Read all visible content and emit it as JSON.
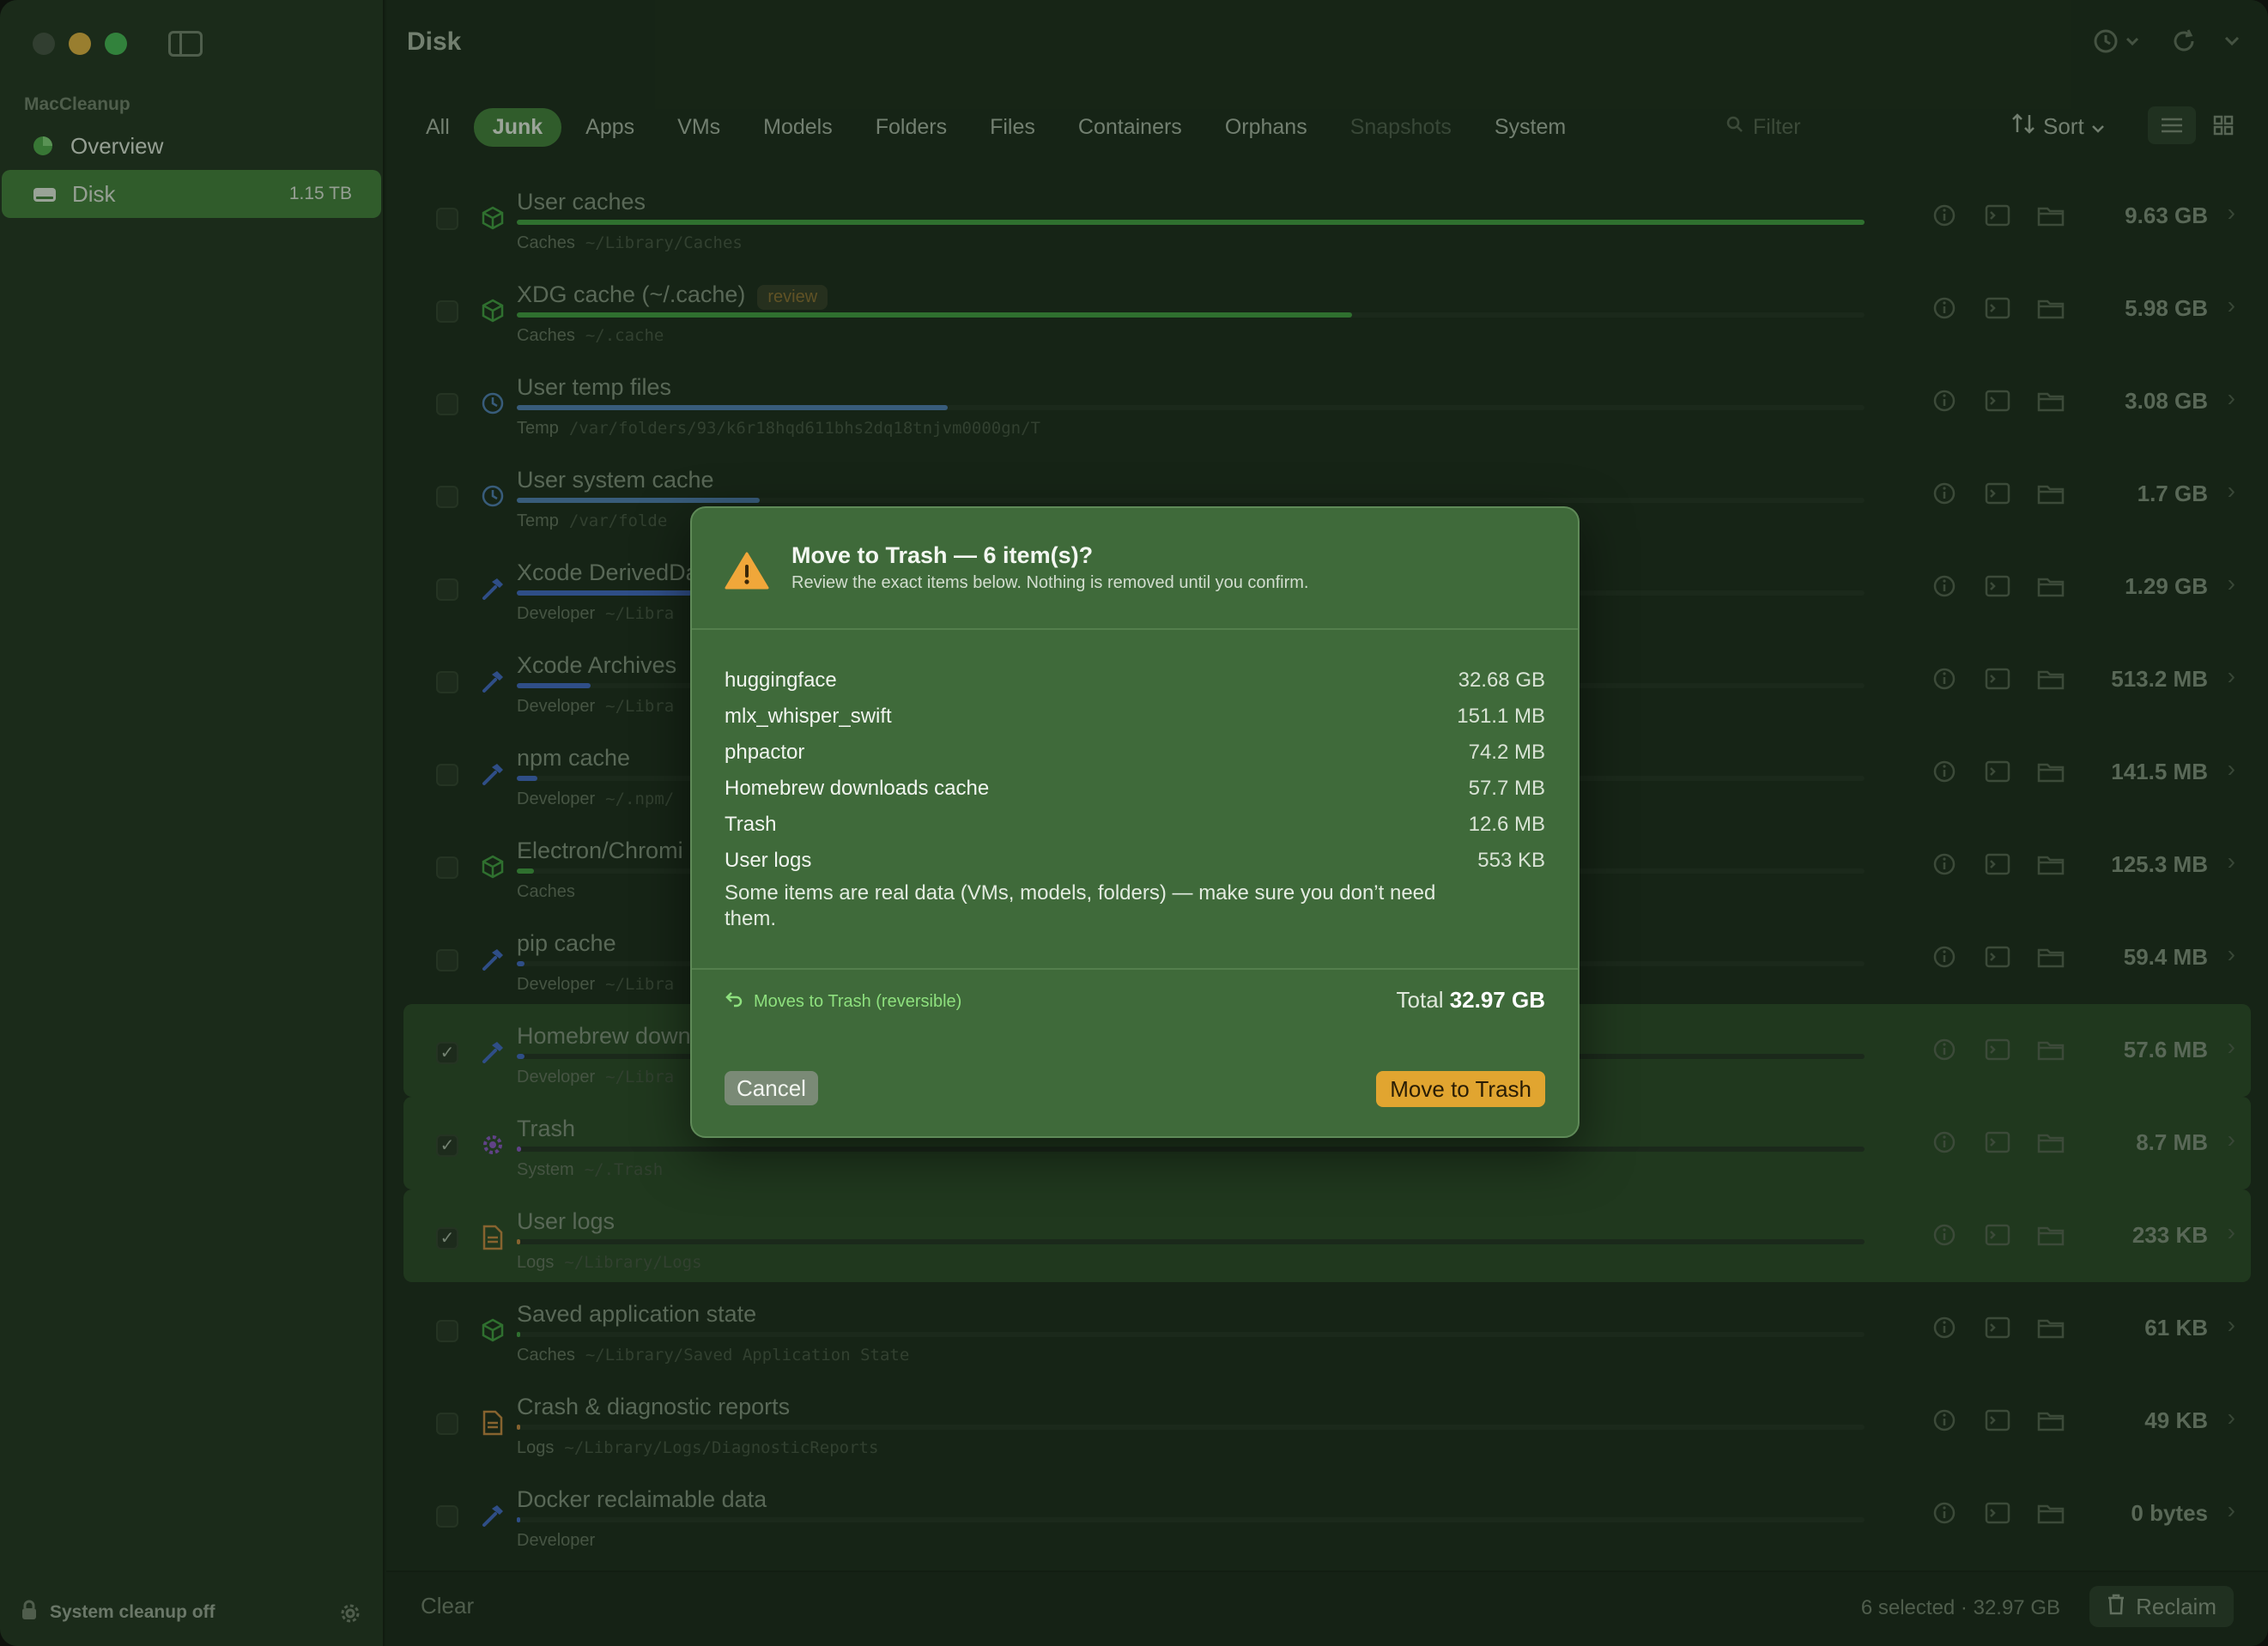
{
  "sidebar": {
    "section": "MacCleanup",
    "items": [
      {
        "label": "Overview",
        "badge": ""
      },
      {
        "label": "Disk",
        "badge": "1.15 TB"
      }
    ],
    "footer": "System cleanup off"
  },
  "header": {
    "title": "Disk",
    "tabs": [
      "All",
      "Junk",
      "Apps",
      "VMs",
      "Models",
      "Folders",
      "Files",
      "Containers",
      "Orphans",
      "Snapshots",
      "System"
    ],
    "active_tab": "Junk",
    "filter_placeholder": "Filter",
    "sort_label": "Sort"
  },
  "rows": [
    {
      "name": "User caches",
      "tag": "",
      "category": "Caches",
      "path": "~/Library/Caches",
      "size": "9.63 GB",
      "fill": 1.0,
      "color": "#3b9a3a",
      "icon": "box-icon",
      "checked": false
    },
    {
      "name": "XDG cache (~/.cache)",
      "tag": "review",
      "category": "Caches",
      "path": "~/.cache",
      "size": "5.98 GB",
      "fill": 0.62,
      "color": "#3b9a3a",
      "icon": "box-icon",
      "checked": false
    },
    {
      "name": "User temp files",
      "tag": "",
      "category": "Temp",
      "path": "/var/folders/93/k6r18hqd611bhs2dq18tnjvm0000gn/T",
      "size": "3.08 GB",
      "fill": 0.32,
      "color": "#4a7ab5",
      "icon": "clock-icon",
      "checked": false
    },
    {
      "name": "User system cache",
      "tag": "",
      "category": "Temp",
      "path": "/var/folde",
      "size": "1.7 GB",
      "fill": 0.18,
      "color": "#4a7ab5",
      "icon": "clock-icon",
      "checked": false
    },
    {
      "name": "Xcode DerivedDa",
      "tag": "",
      "category": "Developer",
      "path": "~/Libra",
      "size": "1.29 GB",
      "fill": 0.13,
      "color": "#3a63c8",
      "icon": "hammer-icon",
      "checked": false
    },
    {
      "name": "Xcode Archives",
      "tag": "",
      "category": "Developer",
      "path": "~/Libra",
      "size": "513.2 MB",
      "fill": 0.055,
      "color": "#3a63c8",
      "icon": "hammer-icon",
      "checked": false
    },
    {
      "name": "npm cache",
      "tag": "",
      "category": "Developer",
      "path": "~/.npm/",
      "size": "141.5 MB",
      "fill": 0.015,
      "color": "#3a63c8",
      "icon": "hammer-icon",
      "checked": false
    },
    {
      "name": "Electron/Chromi",
      "tag": "",
      "category": "Caches",
      "path": "",
      "size": "125.3 MB",
      "fill": 0.013,
      "color": "#3b9a3a",
      "icon": "box-icon",
      "checked": false
    },
    {
      "name": "pip cache",
      "tag": "",
      "category": "Developer",
      "path": "~/Libra",
      "size": "59.4 MB",
      "fill": 0.006,
      "color": "#3a63c8",
      "icon": "hammer-icon",
      "checked": false
    },
    {
      "name": "Homebrew down",
      "tag": "",
      "category": "Developer",
      "path": "~/Libra",
      "size": "57.6 MB",
      "fill": 0.006,
      "color": "#3a63c8",
      "icon": "hammer-icon",
      "checked": true
    },
    {
      "name": "Trash",
      "tag": "",
      "category": "System",
      "path": "~/.Trash",
      "size": "8.7 MB",
      "fill": 0.003,
      "color": "#8a4fc8",
      "icon": "gear-icon",
      "checked": true
    },
    {
      "name": "User logs",
      "tag": "",
      "category": "Logs",
      "path": "~/Library/Logs",
      "size": "233 KB",
      "fill": 0.002,
      "color": "#c9853a",
      "icon": "document-icon",
      "checked": true
    },
    {
      "name": "Saved application state",
      "tag": "",
      "category": "Caches",
      "path": "~/Library/Saved Application State",
      "size": "61 KB",
      "fill": 0.002,
      "color": "#3b9a3a",
      "icon": "box-icon",
      "checked": false
    },
    {
      "name": "Crash & diagnostic reports",
      "tag": "",
      "category": "Logs",
      "path": "~/Library/Logs/DiagnosticReports",
      "size": "49 KB",
      "fill": 0.002,
      "color": "#c9853a",
      "icon": "document-icon",
      "checked": false
    },
    {
      "name": "Docker reclaimable data",
      "tag": "",
      "category": "Developer",
      "path": "",
      "size": "0 bytes",
      "fill": 0.002,
      "color": "#3a63c8",
      "icon": "hammer-icon",
      "checked": false
    }
  ],
  "footer": {
    "clear_label": "Clear",
    "selection_info": "6 selected · 32.97 GB",
    "reclaim_label": "Reclaim"
  },
  "modal": {
    "title": "Move to Trash — 6 item(s)?",
    "subtitle": "Review the exact items below. Nothing is removed until you confirm.",
    "items": [
      {
        "name": "huggingface",
        "size": "32.68 GB"
      },
      {
        "name": "mlx_whisper_swift",
        "size": "151.1 MB"
      },
      {
        "name": "phpactor",
        "size": "74.2 MB"
      },
      {
        "name": "Homebrew downloads cache",
        "size": "57.7 MB"
      },
      {
        "name": "Trash",
        "size": "12.6 MB"
      },
      {
        "name": "User logs",
        "size": "553 KB"
      }
    ],
    "note": "Some items are real data (VMs, models, folders) — make sure you don’t need them.",
    "reversible_label": "Moves to Trash (reversible)",
    "total_label": "Total",
    "total_value": "32.97 GB",
    "cancel_label": "Cancel",
    "confirm_label": "Move to Trash"
  }
}
